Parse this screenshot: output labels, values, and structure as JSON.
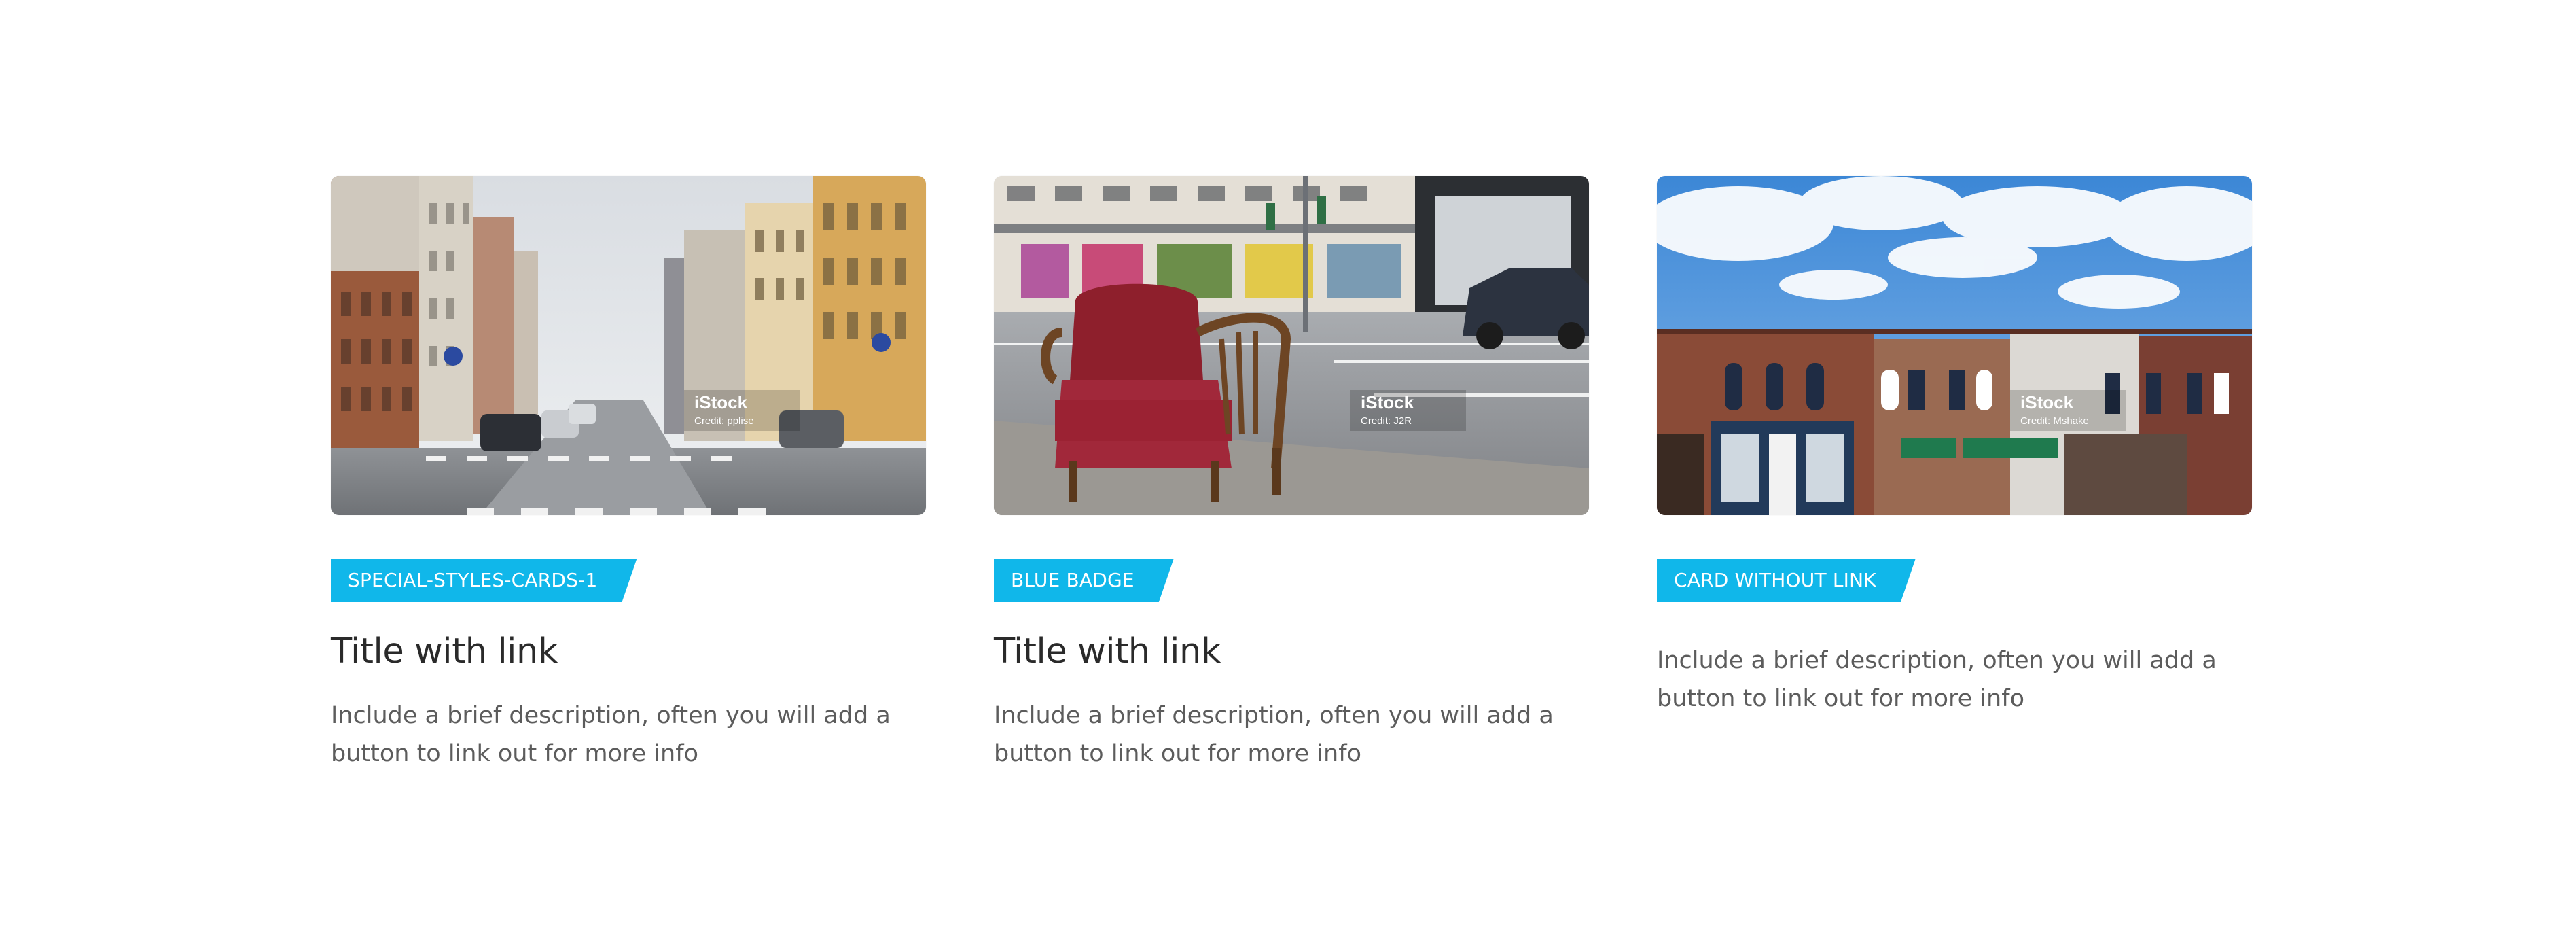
{
  "cards": [
    {
      "badge": "SPECIAL-STYLES-CARDS-1",
      "title": "Title with link",
      "description": "Include a brief description, often you will add a button to link out for more info",
      "image": {
        "subject": "city-street",
        "watermark_logo": "iStock",
        "watermark_credit": "Credit: pplise"
      }
    },
    {
      "badge": "BLUE BADGE",
      "title": "Title with link",
      "description": "Include a brief description, often you will add a button to link out for more info",
      "image": {
        "subject": "red-armchair-on-sidewalk",
        "watermark_logo": "iStock",
        "watermark_credit": "Credit: J2R"
      }
    },
    {
      "badge": "CARD WITHOUT LINK",
      "title": "",
      "description": "Include a brief description, often you will add a button to link out for more info",
      "image": {
        "subject": "small-town-storefronts",
        "watermark_logo": "iStock",
        "watermark_credit": "Credit: Mshake"
      }
    }
  ],
  "colors": {
    "badge_bg": "#10b7ea",
    "badge_text": "#ffffff",
    "title": "#2a2a2a",
    "description": "#5c5c5c",
    "page_bg": "#ffffff"
  }
}
